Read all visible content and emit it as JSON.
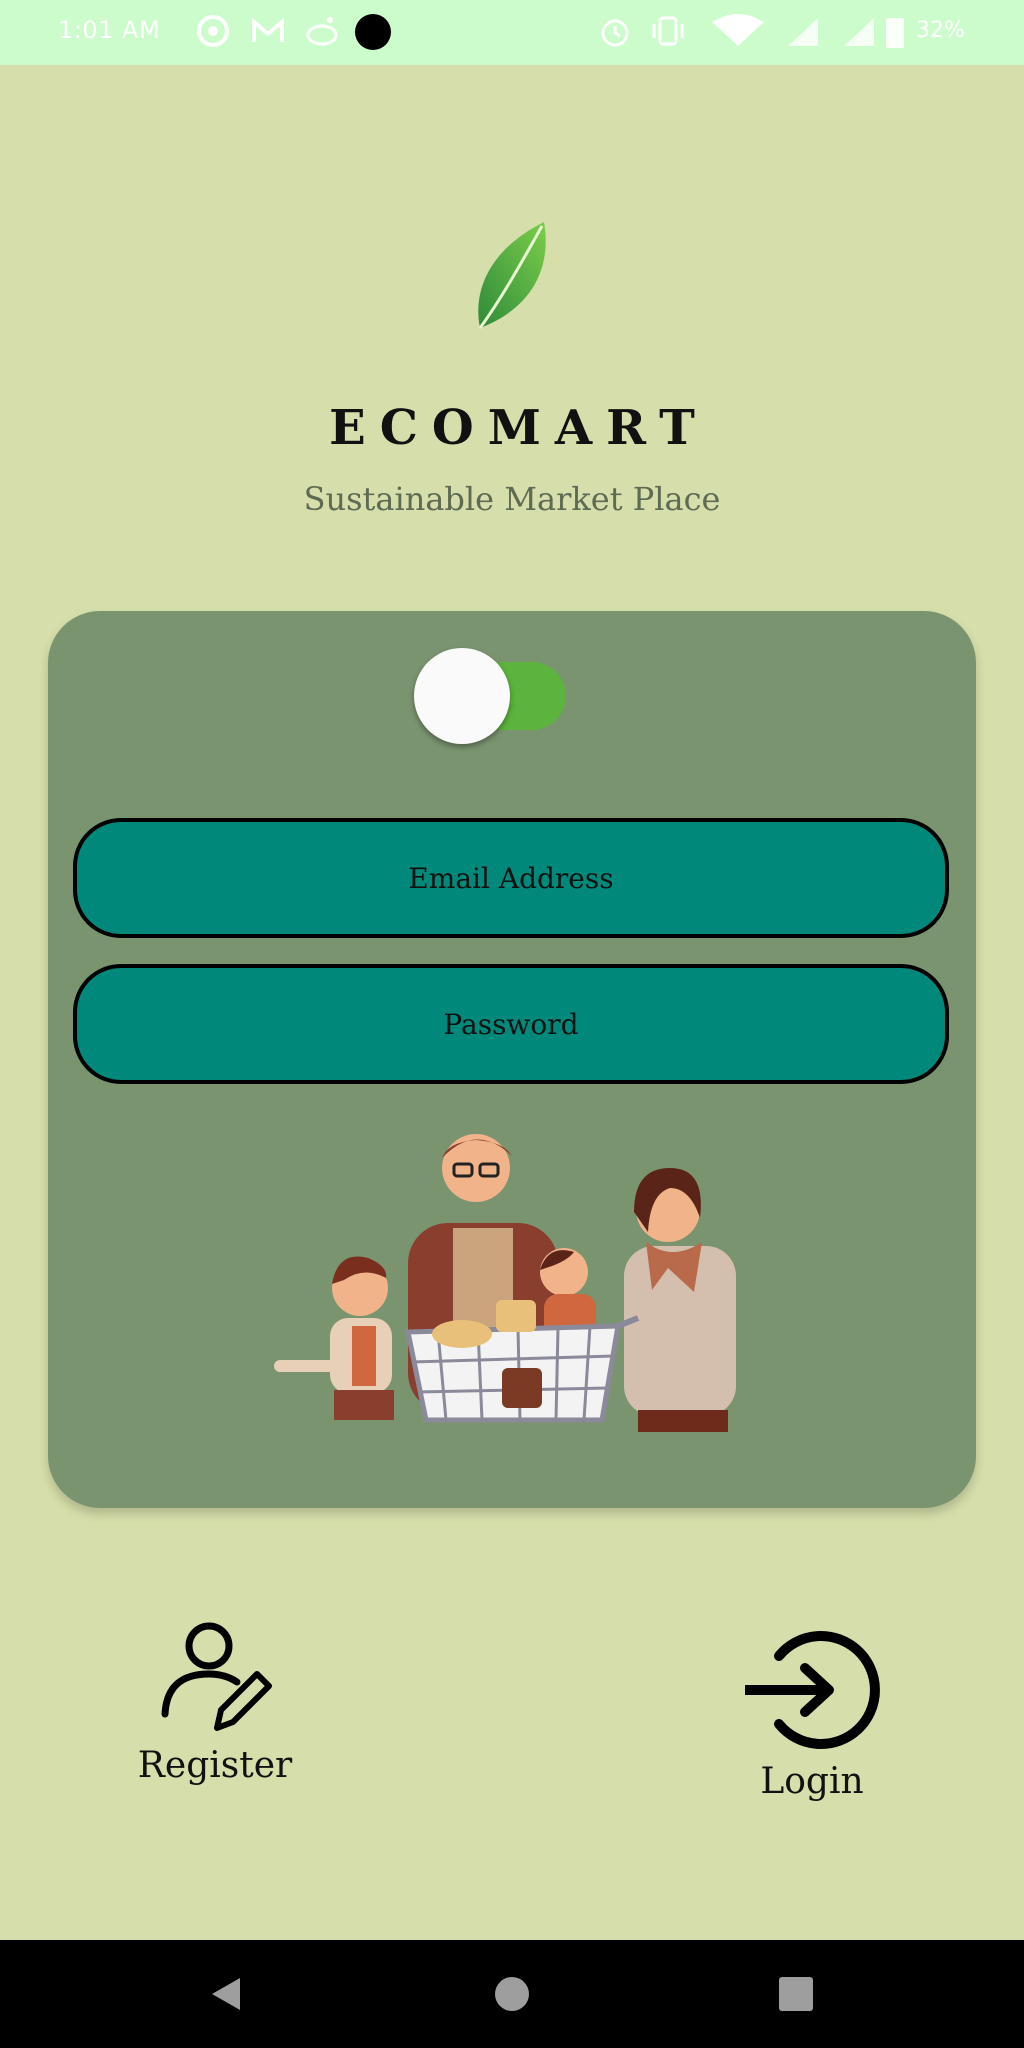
{
  "status_bar": {
    "time": "1:01 AM",
    "battery": "32%",
    "left_icons": [
      "chrome-icon",
      "gmail-icon",
      "reddit-icon",
      "dot-icon"
    ],
    "right_icons": [
      "alarm-icon",
      "vibrate-icon",
      "wifi-icon",
      "signal-icon",
      "battery-icon"
    ]
  },
  "header": {
    "app_name": "ECOMART",
    "tagline": "Sustainable Market Place",
    "logo_icon": "leaf-icon"
  },
  "card": {
    "toggle_on": true,
    "email_placeholder": "Email Address",
    "password_placeholder": "Password",
    "illustration": "family-shopping-illustration"
  },
  "actions": {
    "register_label": "Register",
    "login_label": "Login"
  },
  "colors": {
    "background": "#d6dfab",
    "card": "#7b9470",
    "field": "#00897a",
    "toggle_track": "#5cb33d",
    "leaf": "#4caf35"
  }
}
